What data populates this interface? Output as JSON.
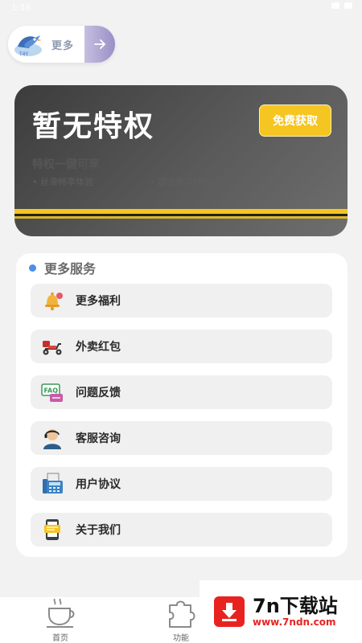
{
  "status_bar": {
    "time": "1:16"
  },
  "more_pill": {
    "label": "更多"
  },
  "privilege_card": {
    "title": "暂无特权",
    "claim_button": "免费获取",
    "subtitle": "特权一键可享",
    "features": [
      "丝滑畅享体验",
      "超值惠选特权"
    ]
  },
  "services": {
    "title": "更多服务",
    "items": [
      {
        "label": "更多福利",
        "icon": "bell-icon"
      },
      {
        "label": "外卖红包",
        "icon": "scooter-icon"
      },
      {
        "label": "问题反馈",
        "icon": "faq-icon"
      },
      {
        "label": "客服咨询",
        "icon": "support-agent-icon"
      },
      {
        "label": "用户协议",
        "icon": "fax-icon"
      },
      {
        "label": "关于我们",
        "icon": "about-icon"
      }
    ]
  },
  "bottom_nav": {
    "items": [
      {
        "label": "首页",
        "icon": "coffee-cup-icon"
      },
      {
        "label": "功能",
        "icon": "puzzle-icon"
      }
    ]
  },
  "watermark": {
    "title": "7n下载站",
    "url": "www.7ndn.com"
  },
  "colors": {
    "accent_yellow": "#f5c521",
    "card_dark": "#3c3c3c",
    "dot_blue": "#4d8ee8",
    "watermark_red": "#e8231f"
  }
}
